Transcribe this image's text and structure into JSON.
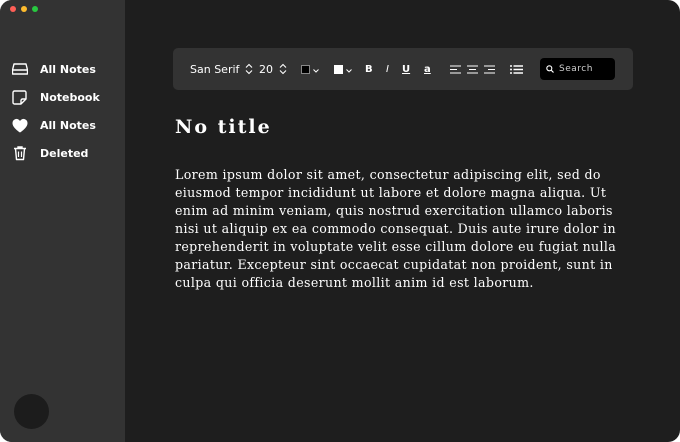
{
  "sidebar": {
    "items": [
      {
        "label": "All Notes",
        "icon": "tray-icon"
      },
      {
        "label": "Notebook",
        "icon": "sticky-note-icon"
      },
      {
        "label": "All Notes",
        "icon": "heart-icon"
      },
      {
        "label": "Deleted",
        "icon": "trash-icon"
      }
    ]
  },
  "toolbar": {
    "font_family": "San Serif",
    "font_size": "20",
    "text_color": "#000000",
    "highlight_color": "#ffffff",
    "bold_label": "B",
    "italic_label": "I",
    "underline_label": "U",
    "text_style_label": "a",
    "search_placeholder": "Search"
  },
  "note": {
    "title": "No title",
    "body": "Lorem ipsum dolor sit amet, consectetur adipiscing elit, sed do eiusmod tempor incididunt ut labore et dolore magna aliqua. Ut enim ad minim veniam, quis nostrud exercitation ullamco laboris nisi ut aliquip ex ea commodo consequat. Duis aute irure dolor in reprehenderit in voluptate velit esse cillum dolore eu fugiat nulla pariatur. Excepteur sint occaecat cupidatat non proident, sunt in culpa qui officia deserunt mollit anim id est laborum."
  },
  "colors": {
    "sidebar_bg": "#333333",
    "content_bg": "#1e1e1e",
    "toolbar_bg": "#333333",
    "search_bg": "#000000"
  }
}
